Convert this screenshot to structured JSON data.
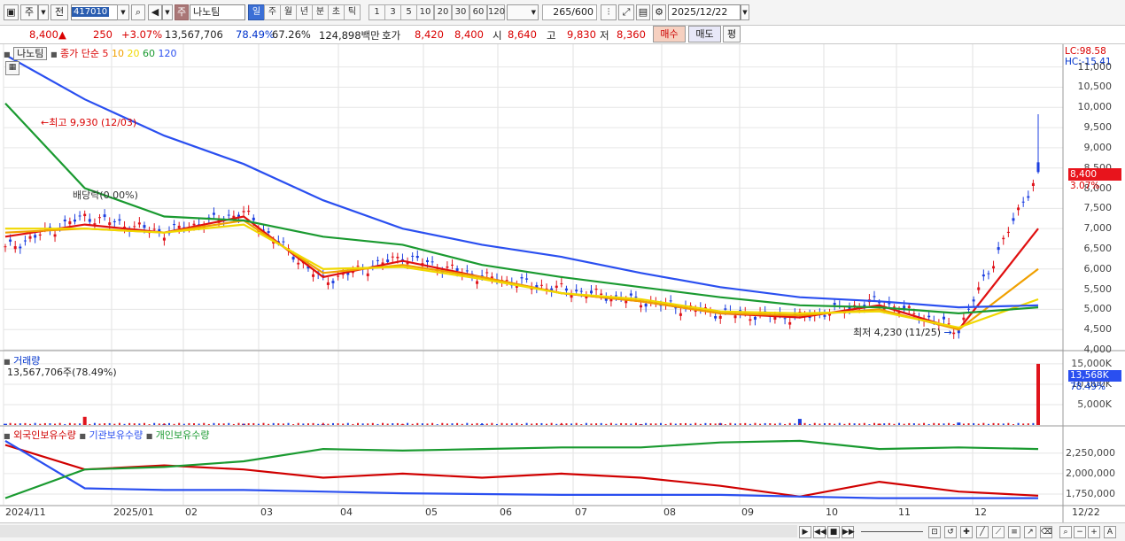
{
  "toolbar": {
    "market_label": "주",
    "prev_label": "전",
    "stock_code": "417010",
    "stock_name_prefix": "주",
    "stock_name": "나노팀",
    "periods": [
      "일",
      "주",
      "월",
      "년",
      "분",
      "초",
      "틱"
    ],
    "minutes": [
      "1",
      "3",
      "5",
      "10",
      "20",
      "30",
      "60",
      "120"
    ],
    "count": "265",
    "count_total": "/600",
    "date": "2025/12/22"
  },
  "quote": {
    "price": "8,400",
    "arrow": "▲",
    "change": "250",
    "change_pct": "+3.07%",
    "volume": "13,567,706",
    "vol_ratio": "78.49%",
    "turnover_pct": "67.26%",
    "amount": "124,898백만",
    "bid_label": "호가",
    "bid1": "8,420",
    "bid2": "8,400",
    "open_label": "시",
    "open": "8,640",
    "high_label": "고",
    "high": "9,830",
    "low_label": "저",
    "low": "8,360",
    "buy_label": "매수",
    "sell_label": "매도",
    "avg_label": "평"
  },
  "price_pane": {
    "stock_label": "나노팀",
    "ma_title": "종가 단순",
    "ma_periods": [
      "5",
      "10",
      "20",
      "60",
      "120"
    ],
    "ma_colors": [
      "#e01010",
      "#f0a000",
      "#f0d800",
      "#1a9a30",
      "#2a4ff0"
    ],
    "lc": "LC:98.58",
    "hc": "HC:-15.41",
    "high_note": "최고 9,930 (12/03)",
    "low_note": "최저 4,230 (11/25)",
    "overlay_note": "배당락(0.00%)",
    "current_price": "8,400",
    "current_pct": "3.07%",
    "y_ticks": [
      "11,000",
      "10,500",
      "10,000",
      "9,500",
      "9,000",
      "8,500",
      "8,000",
      "7,500",
      "7,000",
      "6,500",
      "6,000",
      "5,500",
      "5,000",
      "4,500",
      "4,000"
    ]
  },
  "volume_pane": {
    "title": "거래량",
    "info": "13,567,706주(78.49%)",
    "y_ticks": [
      "15,000K",
      "10,000K",
      "5,000K"
    ],
    "current": "13,568K",
    "current_pct": "78.49%"
  },
  "holding_pane": {
    "titles": [
      "외국인보유수량",
      "기관보유수량",
      "개인보유수량"
    ],
    "colors": [
      "#d00000",
      "#2a4ff0",
      "#1a9a30"
    ],
    "y_ticks": [
      "2,250,000",
      "2,000,000",
      "1,750,000"
    ]
  },
  "x_axis": [
    "2024/11",
    "2025/01",
    "02",
    "03",
    "04",
    "05",
    "06",
    "07",
    "08",
    "09",
    "10",
    "11",
    "12",
    "12/22"
  ],
  "chart_data": {
    "type": "line",
    "x": [
      "2024/11",
      "2025/01",
      "02",
      "03",
      "04",
      "05",
      "06",
      "07",
      "08",
      "09",
      "10",
      "11",
      "12",
      "12/22"
    ],
    "series": [
      {
        "name": "종가",
        "values": [
          6500,
          7300,
          6900,
          7400,
          5700,
          6300,
          5800,
          5500,
          5200,
          4900,
          4800,
          5200,
          4500,
          8400
        ]
      },
      {
        "name": "5",
        "values": [
          6800,
          7100,
          6900,
          7300,
          5800,
          6200,
          5800,
          5400,
          5200,
          4900,
          4800,
          5100,
          4500,
          7000
        ]
      },
      {
        "name": "10",
        "values": [
          6900,
          7000,
          6900,
          7200,
          5900,
          6100,
          5800,
          5400,
          5200,
          4900,
          4850,
          5000,
          4500,
          6000
        ]
      },
      {
        "name": "20",
        "values": [
          7000,
          7000,
          6900,
          7100,
          6000,
          6050,
          5750,
          5400,
          5250,
          4950,
          4900,
          4950,
          4550,
          5250
        ]
      },
      {
        "name": "60",
        "values": [
          10100,
          8000,
          7300,
          7200,
          6800,
          6600,
          6100,
          5800,
          5550,
          5300,
          5100,
          5050,
          4900,
          5050
        ]
      },
      {
        "name": "120",
        "values": [
          11300,
          10200,
          9300,
          8600,
          7700,
          7000,
          6600,
          6300,
          5900,
          5550,
          5300,
          5200,
          5050,
          5100
        ]
      }
    ],
    "volume_series": {
      "name": "거래량",
      "unit": "K",
      "values": [
        300,
        2000,
        200,
        300,
        200,
        150,
        200,
        150,
        200,
        400,
        1500,
        300,
        600,
        15000
      ]
    },
    "holding_series": [
      {
        "name": "외국인보유수량",
        "values": [
          2350000,
          2050000,
          2100000,
          2050000,
          1950000,
          2000000,
          1950000,
          2000000,
          1950000,
          1850000,
          1720000,
          1900000,
          1780000,
          1730000
        ]
      },
      {
        "name": "기관보유수량",
        "values": [
          2400000,
          1820000,
          1800000,
          1800000,
          1780000,
          1760000,
          1750000,
          1740000,
          1740000,
          1740000,
          1720000,
          1700000,
          1700000,
          1700000
        ]
      },
      {
        "name": "개인보유수량",
        "values": [
          1700000,
          2050000,
          2080000,
          2150000,
          2300000,
          2280000,
          2300000,
          2320000,
          2320000,
          2380000,
          2400000,
          2300000,
          2320000,
          2300000
        ]
      }
    ],
    "ylim": [
      4000,
      11300
    ]
  }
}
